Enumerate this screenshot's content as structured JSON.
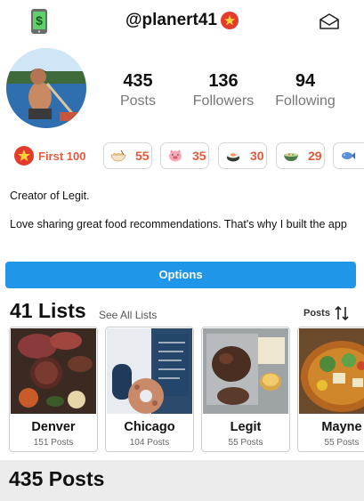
{
  "header": {
    "handle": "@planert41",
    "left_icon": "phone-dollar-icon",
    "right_icon": "envelope-icon",
    "verified_icon": "star-badge-icon"
  },
  "profile": {
    "stats": [
      {
        "value": "435",
        "label": "Posts"
      },
      {
        "value": "136",
        "label": "Followers"
      },
      {
        "value": "94",
        "label": "Following"
      }
    ]
  },
  "badges": {
    "first": {
      "label": "First 100",
      "icon": "star-badge-icon"
    },
    "items": [
      {
        "icon": "noodle-bowl-icon",
        "count": "55"
      },
      {
        "icon": "pig-icon",
        "count": "35"
      },
      {
        "icon": "sushi-icon",
        "count": "30"
      },
      {
        "icon": "soup-bowl-icon",
        "count": "29"
      },
      {
        "icon": "fish-icon",
        "count": ""
      }
    ]
  },
  "bio": {
    "line1": "Creator of Legit.",
    "line2": "Love sharing great food recommendations. That's why I built the app"
  },
  "options_button": "Options",
  "lists": {
    "title": "41 Lists",
    "see_all": "See All Lists",
    "sort_label": "Posts",
    "sort_icon": "sort-arrows-icon",
    "cards": [
      {
        "name": "Denver",
        "posts": "151 Posts"
      },
      {
        "name": "Chicago",
        "posts": "104 Posts"
      },
      {
        "name": "Legit",
        "posts": "55 Posts"
      },
      {
        "name": "Mayne",
        "posts": "55 Posts"
      }
    ]
  },
  "posts_section": {
    "title": "435 Posts"
  },
  "colors": {
    "accent_blue": "#1f96e8",
    "badge_red": "#e53b2c",
    "count_orange": "#e45a3c"
  }
}
